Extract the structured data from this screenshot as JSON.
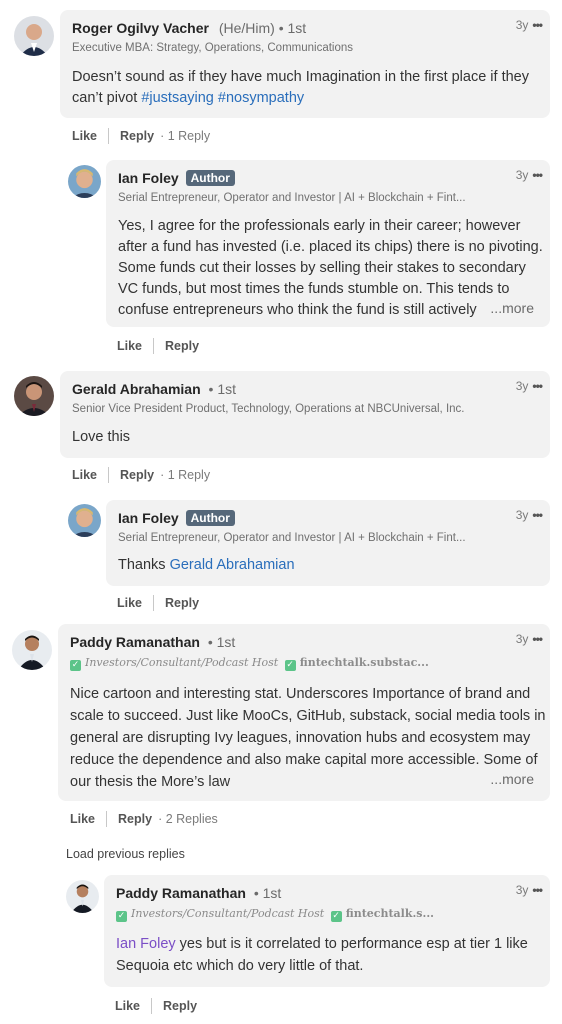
{
  "comments": [
    {
      "name": "Roger Ogilvy Vacher",
      "pronouns": "(He/Him)",
      "degree": "• 1st",
      "headline": "Executive MBA: Strategy, Operations, Communications",
      "time": "3y",
      "menu": "•••",
      "text_lines": [
        "Doesn’t sound as if they have much Imagination in the first place if they",
        "can’t pivot "
      ],
      "hashtags": [
        "#justsaying",
        "#nosympathy"
      ],
      "like": "Like",
      "reply": "Reply",
      "reply_count": "· 1 Reply"
    },
    {
      "name": "Ian Foley",
      "badge": "Author",
      "headline": "Serial Entrepreneur, Operator and Investor | AI + Blockchain + Fint...",
      "time": "3y",
      "menu": "•••",
      "text_lines": [
        "Yes, I agree for the professionals early in their career; however",
        "after a fund has invested (i.e. placed its chips) there is no pivoting.",
        "Some funds cut their losses by selling their stakes to secondary",
        "VC funds, but most times the funds stumble on. This tends to",
        "confuse entrepreneurs who think the fund is still actively"
      ],
      "more": "...more",
      "like": "Like",
      "reply": "Reply"
    },
    {
      "name": "Gerald Abrahamian",
      "degree": "• 1st",
      "headline": "Senior Vice President Product, Technology, Operations at NBCUniversal, Inc.",
      "time": "3y",
      "menu": "•••",
      "text": "Love this",
      "like": "Like",
      "reply": "Reply",
      "reply_count": "· 1 Reply"
    },
    {
      "name": "Ian Foley",
      "badge": "Author",
      "headline": "Serial Entrepreneur, Operator and Investor | AI + Blockchain + Fint...",
      "time": "3y",
      "menu": "•••",
      "text_prefix": "Thanks ",
      "mention": "Gerald Abrahamian",
      "like": "Like",
      "reply": "Reply"
    },
    {
      "name": "Paddy Ramanathan",
      "degree": "• 1st",
      "headline_part1": "Investors/Consultant/Podcast Host",
      "headline_part2": "fintechtalk.substac...",
      "time": "3y",
      "menu": "•••",
      "text_lines": [
        "Nice cartoon and interesting stat. Underscores Importance of brand and",
        "scale to succeed. Just like MooCs, GitHub, substack, social media tools in",
        "general are disrupting Ivy leagues, innovation hubs and ecosystem may",
        "reduce the dependence and also make capital more accessible. Some of",
        "our thesis the More’s law"
      ],
      "more": "...more",
      "like": "Like",
      "reply": "Reply",
      "reply_count": "· 2 Replies"
    },
    {
      "name": "Paddy Ramanathan",
      "degree": "• 1st",
      "headline_part1": "Investors/Consultant/Podcast Host",
      "headline_part2": "fintechtalk.s...",
      "time": "3y",
      "menu": "•••",
      "mention": "Ian Foley",
      "text_lines": [
        " yes but is it correlated to performance esp at tier 1 like",
        "Sequoia etc which do very little of that."
      ],
      "like": "Like",
      "reply": "Reply"
    }
  ],
  "load_previous": "Load previous replies",
  "icons": {
    "check": "✓"
  }
}
